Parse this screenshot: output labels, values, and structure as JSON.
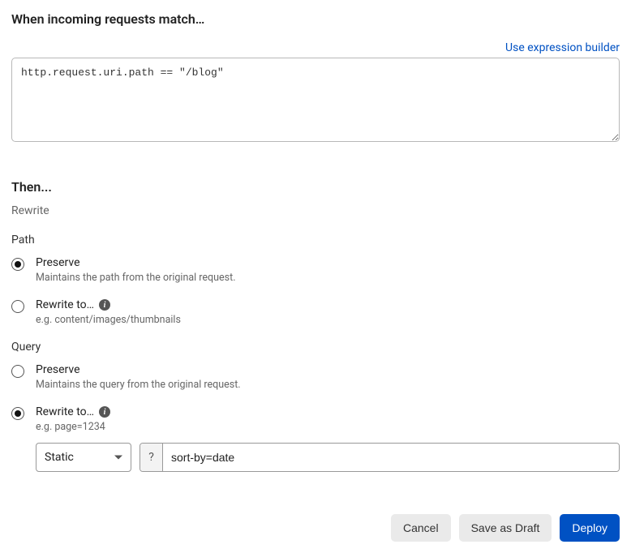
{
  "match": {
    "title": "When incoming requests match…",
    "builder_link": "Use expression builder",
    "expression": "http.request.uri.path == \"/blog\""
  },
  "then": {
    "title": "Then...",
    "action": "Rewrite"
  },
  "path": {
    "label": "Path",
    "preserve": {
      "label": "Preserve",
      "hint": "Maintains the path from the original request.",
      "selected": true
    },
    "rewrite": {
      "label": "Rewrite to…",
      "hint": "e.g. content/images/thumbnails",
      "selected": false
    }
  },
  "query": {
    "label": "Query",
    "preserve": {
      "label": "Preserve",
      "hint": "Maintains the query from the original request.",
      "selected": false
    },
    "rewrite": {
      "label": "Rewrite to…",
      "hint": "e.g. page=1234",
      "selected": true,
      "mode_selected": "Static",
      "prefix": "?",
      "value": "sort-by=date"
    }
  },
  "buttons": {
    "cancel": "Cancel",
    "draft": "Save as Draft",
    "deploy": "Deploy"
  }
}
